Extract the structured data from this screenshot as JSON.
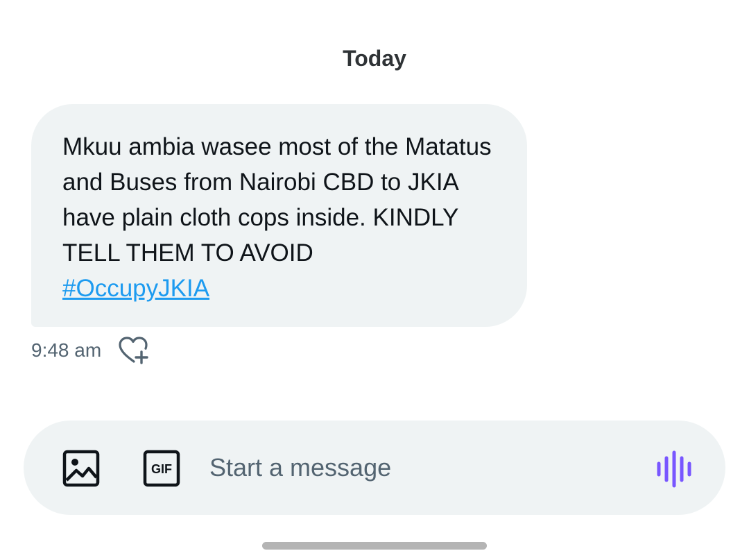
{
  "conversation": {
    "day_divider": "Today",
    "messages": [
      {
        "text": "Mkuu ambia wasee most of the Matatus and Buses from Nairobi CBD to JKIA have plain cloth cops inside. KINDLY TELL THEM TO AVOID",
        "hashtag": "#OccupyJKIA",
        "time": "9:48 am",
        "react_icon": "heart-plus-icon"
      }
    ]
  },
  "composer": {
    "placeholder": "Start a message",
    "image_icon": "image-icon",
    "gif_icon": "gif-icon",
    "gif_label": "GIF",
    "voice_icon": "voice-wave-icon",
    "accent_color": "#7856ff"
  },
  "colors": {
    "bubble_bg": "#eff3f4",
    "link": "#1d9bf0",
    "secondary_text": "#536471"
  }
}
